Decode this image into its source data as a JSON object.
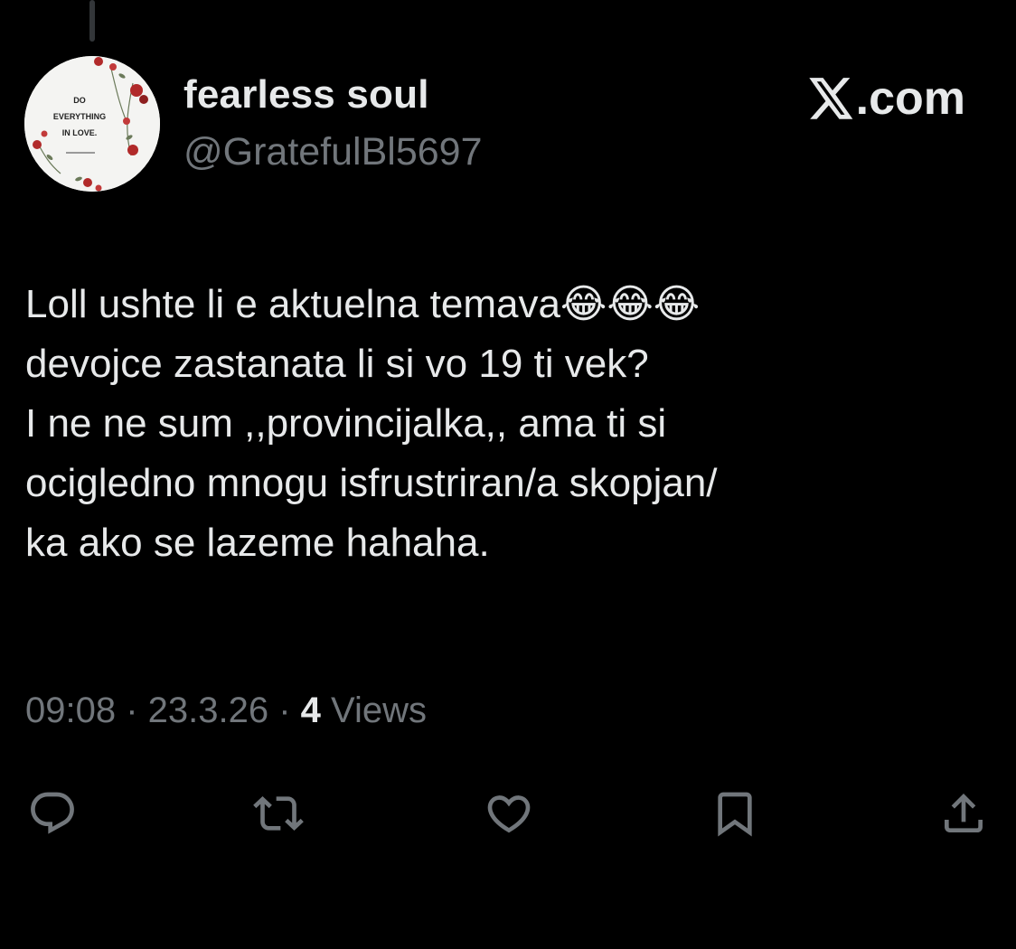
{
  "author": {
    "display_name": "fearless soul",
    "handle": "@GratefulBl5697",
    "avatar": {
      "line1": "DO",
      "line2": "EVERYTHING",
      "line3": "IN LOVE."
    }
  },
  "brand": {
    "label": ".com",
    "icon": "x-logo-icon"
  },
  "tweet": {
    "text": "Loll ushte li e aktuelna temava😂😂😂\ndevojce zastanata li si vo 19 ti vek?\nI ne ne sum ,,provincijalka,, ama ti si\nocigledno mnogu isfrustriran/a skopjan/\nka ako se lazeme hahaha."
  },
  "meta": {
    "time": "09:08",
    "separator": " · ",
    "date": "23.3.26",
    "views_count": "4",
    "views_label": " Views"
  },
  "actions": {
    "icons": [
      "reply-icon",
      "retweet-icon",
      "like-icon",
      "bookmark-icon",
      "share-icon"
    ]
  },
  "colors": {
    "background": "#000000",
    "text_primary": "#e7e9ea",
    "text_secondary": "#71767b",
    "icon": "#71767b"
  }
}
